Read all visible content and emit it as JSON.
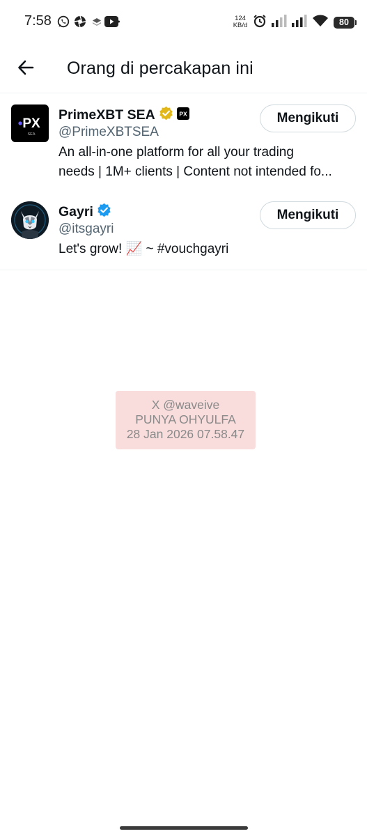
{
  "status_bar": {
    "time": "7:58",
    "net_speed_value": "124",
    "net_speed_unit": "KB/d",
    "battery": "80",
    "left_icons": [
      "whatsapp-icon",
      "camera-shutter-icon",
      "layers-icon",
      "youtube-icon"
    ],
    "right_icons": [
      "alarm-icon",
      "signal-icon",
      "signal-icon",
      "wifi-icon",
      "battery-icon"
    ]
  },
  "header": {
    "back_icon": "arrow-left-icon",
    "title": "Orang di percakapan ini"
  },
  "users": [
    {
      "name": "PrimeXBT SEA",
      "handle": "@PrimeXBTSEA",
      "verified": "gold",
      "affiliate_badge": "PX",
      "avatar_text": "PX",
      "avatar_subtext": "SEA",
      "bio_line1": "An all-in-one platform for all your trading",
      "bio_line2": "needs | 1M+ clients | Content not intended fo...",
      "button_label": "Mengikuti"
    },
    {
      "name": "Gayri",
      "handle": "@itsgayri",
      "verified": "blue",
      "bio": "Let's grow! 📈 ~ #vouchgayri",
      "button_label": "Mengikuti"
    }
  ],
  "watermark": {
    "line1": "X @waveive",
    "line2": "PUNYA OHYULFA",
    "line3": "28 Jan 2026 07.58.47"
  },
  "colors": {
    "text_primary": "#0f1419",
    "text_secondary": "#536471",
    "verified_blue": "#1d9bf0",
    "verified_gold": "#e2b719",
    "watermark_bg": "#f9dcdc"
  }
}
